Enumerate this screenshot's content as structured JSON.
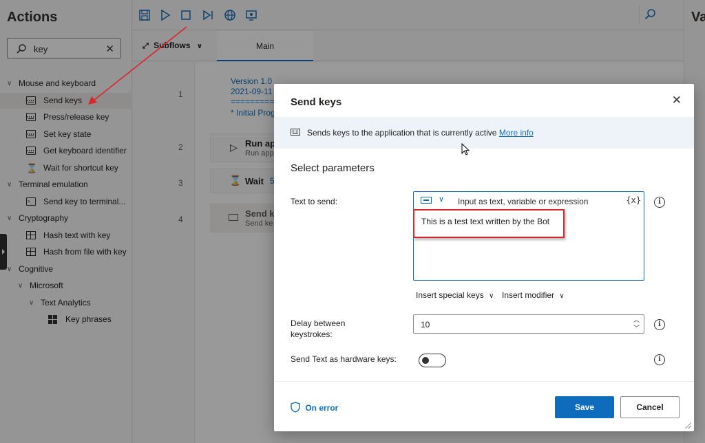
{
  "actions_pane": {
    "title": "Actions",
    "search_value": "key",
    "tree": [
      {
        "label": "Mouse and keyboard",
        "level": 0,
        "type": "group"
      },
      {
        "label": "Send keys",
        "level": 1,
        "type": "keyboard",
        "selected": true
      },
      {
        "label": "Press/release key",
        "level": 1,
        "type": "keyboard"
      },
      {
        "label": "Set key state",
        "level": 1,
        "type": "keyboard"
      },
      {
        "label": "Get keyboard identifier",
        "level": 1,
        "type": "keyboard"
      },
      {
        "label": "Wait for shortcut key",
        "level": 1,
        "type": "hourglass"
      },
      {
        "label": "Terminal emulation",
        "level": 0,
        "type": "group"
      },
      {
        "label": "Send key to terminal...",
        "level": 1,
        "type": "terminal"
      },
      {
        "label": "Cryptography",
        "level": 0,
        "type": "group"
      },
      {
        "label": "Hash text with key",
        "level": 1,
        "type": "hash"
      },
      {
        "label": "Hash from file with key",
        "level": 1,
        "type": "hash"
      },
      {
        "label": "Cognitive",
        "level": 0,
        "type": "group"
      },
      {
        "label": "Microsoft",
        "level": 1,
        "type": "group"
      },
      {
        "label": "Text Analytics",
        "level": 2,
        "type": "group"
      },
      {
        "label": "Key phrases",
        "level": 3,
        "type": "microsoft"
      }
    ]
  },
  "designer": {
    "subflows_label": "Subflows",
    "main_tab_label": "Main",
    "line_numbers": [
      "1",
      "2",
      "3",
      "4"
    ],
    "comment_lines": [
      "Version 1.0",
      "2021-09-11",
      "===========",
      "* Initial Prog"
    ],
    "steps": [
      {
        "title": "Run ap",
        "subtitle": "Run app"
      },
      {
        "title": "Wait",
        "suffix": "5"
      },
      {
        "title": "Send k",
        "subtitle": "Send ke"
      }
    ]
  },
  "variables_pane": {
    "title_fragment": "Va"
  },
  "dialog": {
    "title": "Send keys",
    "info_text": "Sends keys to the application that is currently active",
    "info_link": "More info",
    "section_title": "Select parameters",
    "text_to_send": {
      "label": "Text to send:",
      "placeholder": "Input as text, variable or expression",
      "fx_label": "{x}",
      "value": "This is a test text written by the Bot"
    },
    "insert_special_keys": "Insert special keys",
    "insert_modifier": "Insert modifier",
    "delay": {
      "label_line1": "Delay between",
      "label_line2": "keystrokes:",
      "value": "10"
    },
    "hardware": {
      "label": "Send Text as hardware keys:",
      "enabled": false
    },
    "on_error": "On error",
    "save_label": "Save",
    "cancel_label": "Cancel"
  },
  "colors": {
    "accent": "#0f6cbd",
    "annotation_red": "#d9262c"
  }
}
